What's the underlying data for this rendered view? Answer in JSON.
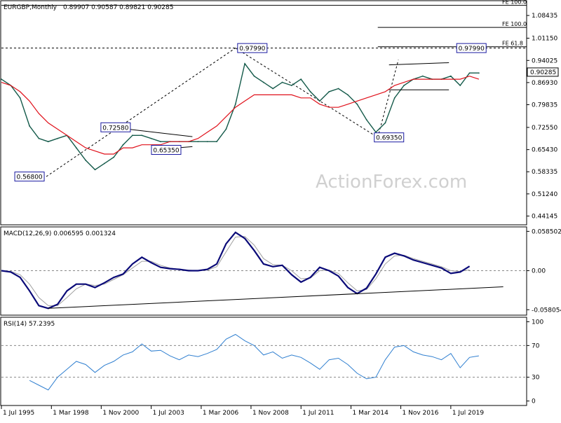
{
  "chart_data": {
    "type": "line",
    "price_panel": {
      "symbol": "EURGBP,Monthly",
      "ohlc_values": "0.89907 0.90587 0.89821 0.90285",
      "yticks": [
        "1.08435",
        "1.01150",
        "0.94025",
        "0.86930",
        "0.79835",
        "0.72550",
        "0.65430",
        "0.58335",
        "0.51240",
        "0.44145"
      ],
      "ylim": [
        0.42,
        1.125
      ],
      "last_price": "0.90285",
      "watermark": "ActionForex.com",
      "fib_levels": [
        {
          "label": "FE 100.0",
          "value": 1.117
        },
        {
          "label": "FE 100.0",
          "value": 1.046
        },
        {
          "label": "FE 61.8",
          "value": 0.9842
        }
      ],
      "horizontal_line": {
        "value": 0.9799
      },
      "pivot_labels": [
        {
          "label": "0.97990",
          "t": 2008.9,
          "value": 0.9799
        },
        {
          "label": "0.72580",
          "t": 2001.6,
          "value": 0.7258
        },
        {
          "label": "0.65350",
          "t": 2004.3,
          "value": 0.6535
        },
        {
          "label": "0.69350",
          "t": 2016.2,
          "value": 0.6935
        },
        {
          "label": "0.56800",
          "t": 1997.0,
          "value": 0.568
        },
        {
          "label": "0.97990",
          "t": 2020.6,
          "value": 0.9799
        }
      ],
      "price_series": [
        [
          1995.5,
          0.88
        ],
        [
          1996.0,
          0.86
        ],
        [
          1996.5,
          0.82
        ],
        [
          1997.0,
          0.73
        ],
        [
          1997.5,
          0.69
        ],
        [
          1998.0,
          0.68
        ],
        [
          1998.5,
          0.69
        ],
        [
          1999.0,
          0.7
        ],
        [
          1999.5,
          0.66
        ],
        [
          2000.0,
          0.62
        ],
        [
          2000.5,
          0.59
        ],
        [
          2001.0,
          0.61
        ],
        [
          2001.5,
          0.63
        ],
        [
          2002.0,
          0.67
        ],
        [
          2002.5,
          0.7
        ],
        [
          2003.0,
          0.7
        ],
        [
          2003.5,
          0.69
        ],
        [
          2004.0,
          0.68
        ],
        [
          2004.5,
          0.68
        ],
        [
          2005.0,
          0.68
        ],
        [
          2005.5,
          0.68
        ],
        [
          2006.0,
          0.68
        ],
        [
          2006.5,
          0.68
        ],
        [
          2007.0,
          0.68
        ],
        [
          2007.5,
          0.72
        ],
        [
          2008.0,
          0.8
        ],
        [
          2008.5,
          0.93
        ],
        [
          2009.0,
          0.89
        ],
        [
          2009.5,
          0.87
        ],
        [
          2010.0,
          0.85
        ],
        [
          2010.5,
          0.87
        ],
        [
          2011.0,
          0.86
        ],
        [
          2011.5,
          0.88
        ],
        [
          2012.0,
          0.84
        ],
        [
          2012.5,
          0.81
        ],
        [
          2013.0,
          0.84
        ],
        [
          2013.5,
          0.85
        ],
        [
          2014.0,
          0.83
        ],
        [
          2014.5,
          0.8
        ],
        [
          2015.0,
          0.75
        ],
        [
          2015.5,
          0.71
        ],
        [
          2016.0,
          0.74
        ],
        [
          2016.5,
          0.82
        ],
        [
          2017.0,
          0.86
        ],
        [
          2017.5,
          0.88
        ],
        [
          2018.0,
          0.89
        ],
        [
          2018.5,
          0.88
        ],
        [
          2019.0,
          0.88
        ],
        [
          2019.5,
          0.89
        ],
        [
          2020.0,
          0.86
        ],
        [
          2020.5,
          0.9
        ],
        [
          2021.0,
          0.9
        ]
      ],
      "ma_series": [
        [
          1995.5,
          0.87
        ],
        [
          1996.0,
          0.86
        ],
        [
          1996.5,
          0.84
        ],
        [
          1997.0,
          0.81
        ],
        [
          1997.5,
          0.77
        ],
        [
          1998.0,
          0.74
        ],
        [
          1998.5,
          0.72
        ],
        [
          1999.0,
          0.7
        ],
        [
          1999.5,
          0.68
        ],
        [
          2000.0,
          0.66
        ],
        [
          2000.5,
          0.65
        ],
        [
          2001.0,
          0.64
        ],
        [
          2001.5,
          0.64
        ],
        [
          2002.0,
          0.66
        ],
        [
          2002.5,
          0.66
        ],
        [
          2003.0,
          0.67
        ],
        [
          2003.5,
          0.67
        ],
        [
          2004.0,
          0.67
        ],
        [
          2004.5,
          0.68
        ],
        [
          2005.0,
          0.68
        ],
        [
          2005.5,
          0.68
        ],
        [
          2006.0,
          0.69
        ],
        [
          2006.5,
          0.71
        ],
        [
          2007.0,
          0.73
        ],
        [
          2007.5,
          0.76
        ],
        [
          2008.0,
          0.79
        ],
        [
          2008.5,
          0.81
        ],
        [
          2009.0,
          0.83
        ],
        [
          2009.5,
          0.83
        ],
        [
          2010.0,
          0.83
        ],
        [
          2010.5,
          0.83
        ],
        [
          2011.0,
          0.83
        ],
        [
          2011.5,
          0.82
        ],
        [
          2012.0,
          0.82
        ],
        [
          2012.5,
          0.8
        ],
        [
          2013.0,
          0.79
        ],
        [
          2013.5,
          0.79
        ],
        [
          2014.0,
          0.8
        ],
        [
          2014.5,
          0.81
        ],
        [
          2015.0,
          0.82
        ],
        [
          2015.5,
          0.83
        ],
        [
          2016.0,
          0.84
        ],
        [
          2016.5,
          0.86
        ],
        [
          2017.0,
          0.87
        ],
        [
          2017.5,
          0.88
        ],
        [
          2018.0,
          0.88
        ],
        [
          2018.5,
          0.88
        ],
        [
          2019.0,
          0.88
        ],
        [
          2019.5,
          0.88
        ],
        [
          2020.0,
          0.88
        ],
        [
          2020.5,
          0.89
        ],
        [
          2021.0,
          0.88
        ]
      ],
      "trend_lines": [
        {
          "from": [
            2001.4,
            0.7258
          ],
          "to": [
            2005.7,
            0.696
          ]
        },
        {
          "from": [
            2003.5,
            0.6535
          ],
          "to": [
            2005.7,
            0.664
          ]
        },
        {
          "from": [
            2016.2,
            0.926
          ],
          "to": [
            2019.4,
            0.933
          ]
        },
        {
          "from": [
            2016.2,
            0.846
          ],
          "to": [
            2019.4,
            0.846
          ]
        }
      ],
      "projection_lines": [
        {
          "from": [
            1997.9,
            0.568
          ],
          "to": [
            2008.0,
            0.9799
          ]
        },
        {
          "from": [
            2008.0,
            0.9799
          ],
          "to": [
            2015.6,
            0.6935
          ]
        },
        {
          "from": [
            2015.6,
            0.6935
          ],
          "to": [
            2016.7,
            0.942
          ]
        }
      ]
    },
    "macd_panel": {
      "label": "MACD(12,26,9) 0.006595 0.001324",
      "yticks": [
        "0.058502",
        "0.00",
        "-0.058054"
      ],
      "ylim": [
        -0.063,
        0.062
      ],
      "macd_series": [
        [
          1995.5,
          0.0
        ],
        [
          1996.0,
          -0.002
        ],
        [
          1996.5,
          -0.01
        ],
        [
          1997.0,
          -0.03
        ],
        [
          1997.5,
          -0.052
        ],
        [
          1998.0,
          -0.056
        ],
        [
          1998.5,
          -0.05
        ],
        [
          1999.0,
          -0.03
        ],
        [
          1999.5,
          -0.02
        ],
        [
          2000.0,
          -0.02
        ],
        [
          2000.5,
          -0.025
        ],
        [
          2001.0,
          -0.018
        ],
        [
          2001.5,
          -0.01
        ],
        [
          2002.0,
          -0.005
        ],
        [
          2002.5,
          0.01
        ],
        [
          2003.0,
          0.02
        ],
        [
          2003.5,
          0.012
        ],
        [
          2004.0,
          0.005
        ],
        [
          2004.5,
          0.003
        ],
        [
          2005.0,
          0.002
        ],
        [
          2005.5,
          0.0
        ],
        [
          2006.0,
          0.0
        ],
        [
          2006.5,
          0.002
        ],
        [
          2007.0,
          0.01
        ],
        [
          2007.5,
          0.04
        ],
        [
          2008.0,
          0.057
        ],
        [
          2008.5,
          0.048
        ],
        [
          2009.0,
          0.03
        ],
        [
          2009.5,
          0.01
        ],
        [
          2010.0,
          0.006
        ],
        [
          2010.5,
          0.008
        ],
        [
          2011.0,
          -0.006
        ],
        [
          2011.5,
          -0.017
        ],
        [
          2012.0,
          -0.01
        ],
        [
          2012.5,
          0.005
        ],
        [
          2013.0,
          0.0
        ],
        [
          2013.5,
          -0.008
        ],
        [
          2014.0,
          -0.025
        ],
        [
          2014.5,
          -0.034
        ],
        [
          2015.0,
          -0.026
        ],
        [
          2015.5,
          -0.005
        ],
        [
          2016.0,
          0.02
        ],
        [
          2016.5,
          0.026
        ],
        [
          2017.0,
          0.022
        ],
        [
          2017.5,
          0.016
        ],
        [
          2018.0,
          0.012
        ],
        [
          2018.5,
          0.008
        ],
        [
          2019.0,
          0.004
        ],
        [
          2019.5,
          -0.004
        ],
        [
          2020.0,
          -0.002
        ],
        [
          2020.5,
          0.0066
        ]
      ],
      "signal_series": [
        [
          1995.5,
          0.0
        ],
        [
          1996.0,
          -0.001
        ],
        [
          1996.5,
          -0.006
        ],
        [
          1997.0,
          -0.02
        ],
        [
          1997.5,
          -0.04
        ],
        [
          1998.0,
          -0.052
        ],
        [
          1998.5,
          -0.052
        ],
        [
          1999.0,
          -0.04
        ],
        [
          1999.5,
          -0.027
        ],
        [
          2000.0,
          -0.02
        ],
        [
          2000.5,
          -0.022
        ],
        [
          2001.0,
          -0.02
        ],
        [
          2001.5,
          -0.013
        ],
        [
          2002.0,
          -0.006
        ],
        [
          2002.5,
          0.004
        ],
        [
          2003.0,
          0.014
        ],
        [
          2003.5,
          0.014
        ],
        [
          2004.0,
          0.008
        ],
        [
          2004.5,
          0.004
        ],
        [
          2005.0,
          0.002
        ],
        [
          2005.5,
          0.001
        ],
        [
          2006.0,
          0.0
        ],
        [
          2006.5,
          0.001
        ],
        [
          2007.0,
          0.006
        ],
        [
          2007.5,
          0.028
        ],
        [
          2008.0,
          0.05
        ],
        [
          2008.5,
          0.051
        ],
        [
          2009.0,
          0.038
        ],
        [
          2009.5,
          0.018
        ],
        [
          2010.0,
          0.009
        ],
        [
          2010.5,
          0.008
        ],
        [
          2011.0,
          0.0
        ],
        [
          2011.5,
          -0.012
        ],
        [
          2012.0,
          -0.011
        ],
        [
          2012.5,
          0.0
        ],
        [
          2013.0,
          0.001
        ],
        [
          2013.5,
          -0.004
        ],
        [
          2014.0,
          -0.018
        ],
        [
          2014.5,
          -0.03
        ],
        [
          2015.0,
          -0.028
        ],
        [
          2015.5,
          -0.012
        ],
        [
          2016.0,
          0.01
        ],
        [
          2016.5,
          0.022
        ],
        [
          2017.0,
          0.023
        ],
        [
          2017.5,
          0.018
        ],
        [
          2018.0,
          0.014
        ],
        [
          2018.5,
          0.01
        ],
        [
          2019.0,
          0.006
        ],
        [
          2019.5,
          0.0
        ],
        [
          2020.0,
          -0.001
        ],
        [
          2020.5,
          0.0013
        ]
      ],
      "support_line": {
        "from": [
          1998.0,
          -0.056
        ],
        "to": [
          2022.3,
          -0.024
        ]
      }
    },
    "rsi_panel": {
      "label": "RSI(14) 57.2395",
      "yticks": [
        "100",
        "70",
        "30",
        "0"
      ],
      "ylim": [
        -3,
        103
      ],
      "levels": [
        70,
        30
      ],
      "rsi_series": [
        [
          1997.0,
          26
        ],
        [
          1997.5,
          20
        ],
        [
          1998.0,
          14
        ],
        [
          1998.5,
          30
        ],
        [
          1999.0,
          40
        ],
        [
          1999.5,
          50
        ],
        [
          2000.0,
          46
        ],
        [
          2000.5,
          36
        ],
        [
          2001.0,
          45
        ],
        [
          2001.5,
          50
        ],
        [
          2002.0,
          58
        ],
        [
          2002.5,
          62
        ],
        [
          2003.0,
          72
        ],
        [
          2003.5,
          63
        ],
        [
          2004.0,
          64
        ],
        [
          2004.5,
          57
        ],
        [
          2005.0,
          52
        ],
        [
          2005.5,
          58
        ],
        [
          2006.0,
          56
        ],
        [
          2006.5,
          60
        ],
        [
          2007.0,
          65
        ],
        [
          2007.5,
          78
        ],
        [
          2008.0,
          84
        ],
        [
          2008.5,
          76
        ],
        [
          2009.0,
          70
        ],
        [
          2009.5,
          58
        ],
        [
          2010.0,
          62
        ],
        [
          2010.5,
          54
        ],
        [
          2011.0,
          58
        ],
        [
          2011.5,
          55
        ],
        [
          2012.0,
          48
        ],
        [
          2012.5,
          40
        ],
        [
          2013.0,
          52
        ],
        [
          2013.5,
          54
        ],
        [
          2014.0,
          46
        ],
        [
          2014.5,
          35
        ],
        [
          2015.0,
          28
        ],
        [
          2015.5,
          30
        ],
        [
          2016.0,
          52
        ],
        [
          2016.5,
          68
        ],
        [
          2017.0,
          70
        ],
        [
          2017.5,
          62
        ],
        [
          2018.0,
          58
        ],
        [
          2018.5,
          56
        ],
        [
          2019.0,
          52
        ],
        [
          2019.5,
          60
        ],
        [
          2020.0,
          42
        ],
        [
          2020.5,
          55
        ],
        [
          2021.0,
          57
        ]
      ]
    },
    "x_axis": {
      "ticks": [
        {
          "label": "1 Jul 1995",
          "t": 1995.5
        },
        {
          "label": "1 Mar 1998",
          "t": 1998.17
        },
        {
          "label": "1 Nov 2000",
          "t": 2000.83
        },
        {
          "label": "1 Jul 2003",
          "t": 2003.5
        },
        {
          "label": "1 Mar 2006",
          "t": 2006.17
        },
        {
          "label": "1 Nov 2008",
          "t": 2008.83
        },
        {
          "label": "1 Jul 2011",
          "t": 2011.5
        },
        {
          "label": "1 Mar 2014",
          "t": 2014.17
        },
        {
          "label": "1 Nov 2016",
          "t": 2016.83
        },
        {
          "label": "1 Jul 2019",
          "t": 2019.5
        }
      ],
      "xlim": [
        1995.5,
        2023.55
      ]
    },
    "colors": {
      "price": "#145a4a",
      "ma": "#e0101a",
      "macd": "#0a0a78",
      "signal": "#a0a0a0",
      "rsi": "#2f7fd0",
      "label_border": "#1a1aa0",
      "watermark": "#d0d0d0"
    }
  }
}
